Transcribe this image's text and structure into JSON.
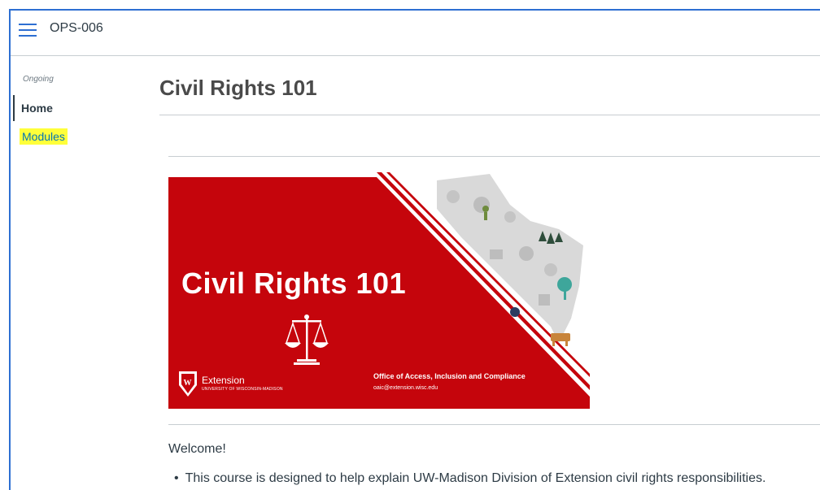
{
  "header": {
    "course_code": "OPS-006"
  },
  "nav": {
    "term": "Ongoing",
    "items": [
      {
        "label": "Home",
        "active": true
      },
      {
        "label": "Modules",
        "highlighted": true
      }
    ]
  },
  "page": {
    "title": "Civil Rights 101"
  },
  "banner": {
    "title": "Civil Rights 101",
    "office": "Office of Access, Inclusion and Compliance",
    "email": "oaic@extension.wisc.edu",
    "logo_name": "Extension",
    "logo_sub": "UNIVERSITY OF WISCONSIN-MADISON",
    "colors": {
      "red": "#c5050c",
      "white": "#ffffff",
      "gray": "#d9d9d9"
    }
  },
  "content": {
    "welcome": "Welcome!",
    "bullets": [
      "This course is designed to help explain UW-Madison Division of Extension civil rights responsibilities."
    ]
  },
  "colors": {
    "accent": "#2d6fd2",
    "link": "#0374b5",
    "highlight": "#ffff3a"
  }
}
